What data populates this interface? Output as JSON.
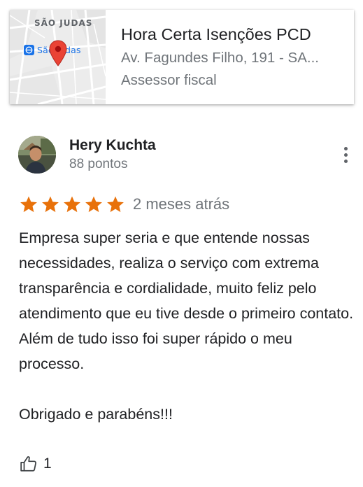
{
  "place": {
    "map_area_label": "SÃO JUDAS",
    "map_metro_label": "São Judas",
    "name": "Hora Certa Isenções PCD",
    "address": "Av. Fagundes Filho, 191 - SA...",
    "category": "Assessor fiscal",
    "icons": {
      "metro": "metro-station-icon",
      "pin": "map-pin-icon"
    },
    "colors": {
      "pin": "#ea4335",
      "metro": "#1a73e8"
    }
  },
  "review": {
    "author": "Hery Kuchta",
    "author_meta": "88 pontos",
    "rating": 5,
    "rating_max": 5,
    "date": "2 meses atrás",
    "paragraphs": [
      "Empresa super seria e que entende nossas necessidades, realiza o serviço com extrema transparência e cordialidade, muito feliz pelo atendimento que eu tive desde o primeiro contato. Além de tudo isso foi super rápido o meu processo.",
      "Obrigado e parabéns!!!"
    ],
    "likes": "1",
    "colors": {
      "star": "#e8710a"
    },
    "icons": {
      "more": "more-vertical-icon",
      "like": "thumbs-up-icon",
      "star": "star-icon"
    }
  }
}
